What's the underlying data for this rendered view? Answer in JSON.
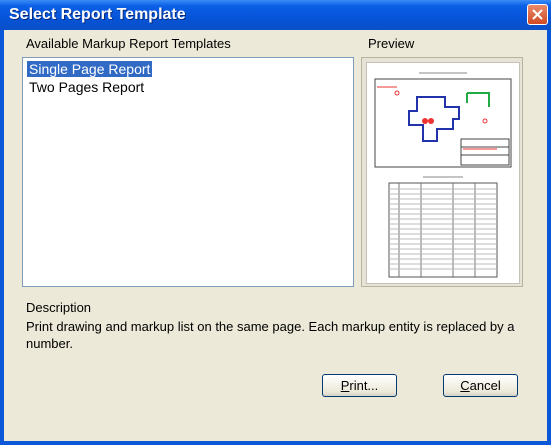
{
  "window": {
    "title": "Select Report Template"
  },
  "templates": {
    "label": "Available Markup Report Templates",
    "items": [
      "Single Page Report",
      "Two Pages Report"
    ],
    "selected_index": 0
  },
  "preview": {
    "label": "Preview"
  },
  "description": {
    "label": "Description",
    "text": "Print drawing and markup list on the same page. Each markup entity is replaced by a number."
  },
  "buttons": {
    "print": {
      "accel": "P",
      "rest": "rint..."
    },
    "cancel": {
      "accel": "C",
      "rest": "ancel"
    }
  },
  "colors": {
    "title_bar": "#0654d8",
    "selection": "#316ac5",
    "dialog_bg": "#ece9d8"
  }
}
